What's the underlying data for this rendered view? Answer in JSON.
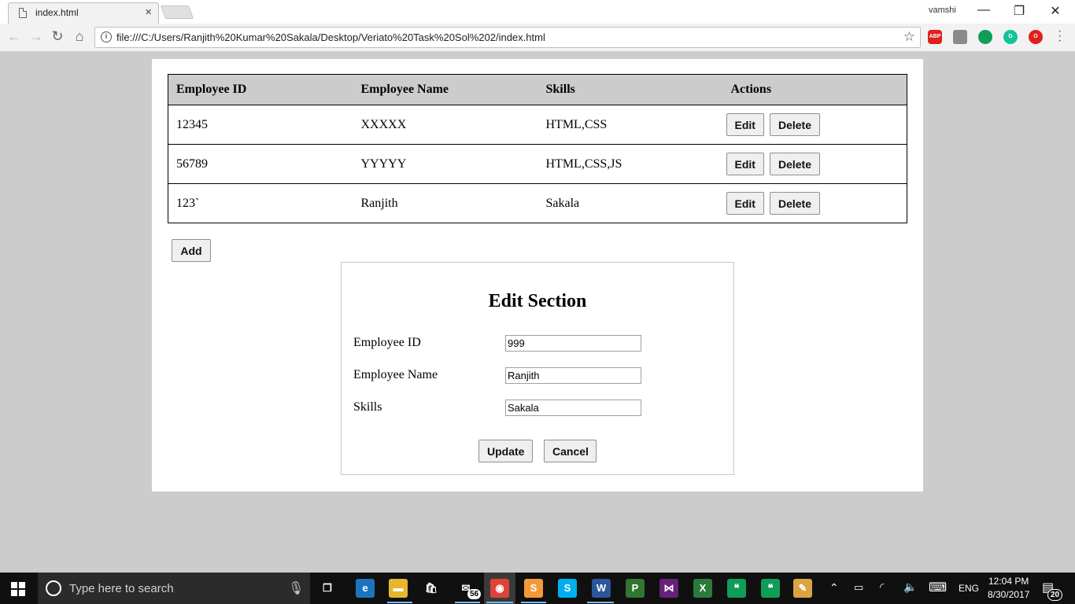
{
  "browser": {
    "tab_title": "index.html",
    "tab_close": "×",
    "profile_name": "vamshi",
    "window_controls": {
      "minimize": "—",
      "restore": "❐",
      "close": "✕"
    },
    "nav": {
      "back": "←",
      "forward": "→",
      "reload": "↻",
      "home": "⌂"
    },
    "url": "file:///C:/Users/Ranjith%20Kumar%20Sakala/Desktop/Veriato%20Task%20Sol%202/index.html",
    "info_icon": "i",
    "extensions": [
      {
        "name": "adblock-plus",
        "label": "ABP",
        "color": "#e0201b"
      },
      {
        "name": "extension-gray",
        "label": "",
        "color": "#8a8a8a"
      },
      {
        "name": "hangouts",
        "label": "",
        "color": "#0f9d58"
      },
      {
        "name": "grammarly",
        "label": "G",
        "color": "#15c39a"
      },
      {
        "name": "opera",
        "label": "O",
        "color": "#e0201b"
      }
    ]
  },
  "table": {
    "headers": [
      "Employee ID",
      "Employee Name",
      "Skills",
      "Actions"
    ],
    "rows": [
      {
        "id": "12345",
        "name": "XXXXX",
        "skills": "HTML,CSS"
      },
      {
        "id": "56789",
        "name": "YYYYY",
        "skills": "HTML,CSS,JS"
      },
      {
        "id": "123`",
        "name": "Ranjith",
        "skills": "Sakala"
      }
    ],
    "edit_label": "Edit",
    "delete_label": "Delete"
  },
  "add_label": "Add",
  "edit_section": {
    "title": "Edit Section",
    "fields": [
      {
        "label": "Employee ID",
        "value": "999"
      },
      {
        "label": "Employee Name",
        "value": "Ranjith"
      },
      {
        "label": "Skills",
        "value": "Sakala"
      }
    ],
    "update_label": "Update",
    "cancel_label": "Cancel"
  },
  "taskbar": {
    "search_placeholder": "Type here to search",
    "mail_badge": "56",
    "language": "ENG",
    "time": "12:04 PM",
    "date": "8/30/2017",
    "notification_count": "20",
    "apps": [
      {
        "name": "task-view",
        "glyph": "❐",
        "color": "transparent"
      },
      {
        "name": "edge",
        "glyph": "e",
        "color": "#1e73be"
      },
      {
        "name": "file-explorer",
        "glyph": "▬",
        "color": "#e8b530"
      },
      {
        "name": "store",
        "glyph": "🛍",
        "color": "transparent"
      },
      {
        "name": "mail",
        "glyph": "✉",
        "color": "transparent"
      },
      {
        "name": "chrome",
        "glyph": "◉",
        "color": "#db4437"
      },
      {
        "name": "sublime",
        "glyph": "S",
        "color": "#f29a3a"
      },
      {
        "name": "skype",
        "glyph": "S",
        "color": "#00aff0"
      },
      {
        "name": "word",
        "glyph": "W",
        "color": "#2b579a"
      },
      {
        "name": "project",
        "glyph": "P",
        "color": "#31752f"
      },
      {
        "name": "visual-studio",
        "glyph": "⋈",
        "color": "#68217a"
      },
      {
        "name": "excel-package",
        "glyph": "X",
        "color": "#2b7a3b"
      },
      {
        "name": "hangouts-1",
        "glyph": "❝",
        "color": "#0f9d58"
      },
      {
        "name": "hangouts-2",
        "glyph": "❝",
        "color": "#0f9d58"
      },
      {
        "name": "paint",
        "glyph": "✎",
        "color": "#d9a441"
      }
    ]
  }
}
